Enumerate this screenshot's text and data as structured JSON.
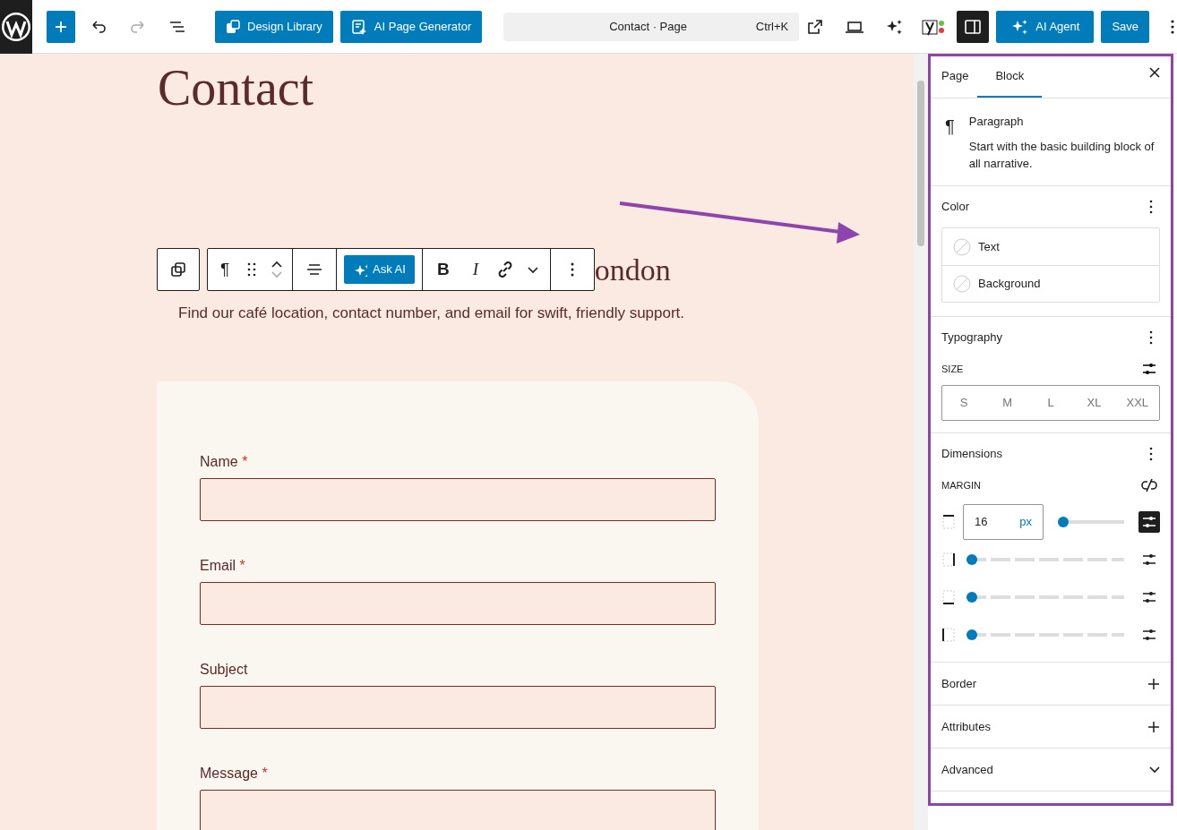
{
  "topbar": {
    "design_library": "Design Library",
    "ai_page_generator": "AI Page Generator",
    "command": {
      "title": "Contact · Page",
      "shortcut": "Ctrl+K"
    },
    "sidebar_toggle": {
      "on": true
    },
    "ai_agent": "AI Agent",
    "save": "Save"
  },
  "canvas": {
    "title": "Contact",
    "heading_fragment": "ondon",
    "block_toolbar": {
      "paragraph_glyph": "¶",
      "ask_ai": "Ask AI",
      "bold": "B",
      "italic": "I"
    },
    "paragraph": "Find our café location, contact number, and email for swift, friendly support.",
    "form": {
      "fields": [
        {
          "label": "Name",
          "required": true,
          "kind": "input"
        },
        {
          "label": "Email",
          "required": true,
          "kind": "input"
        },
        {
          "label": "Subject",
          "required": false,
          "kind": "input"
        },
        {
          "label": "Message",
          "required": true,
          "kind": "textarea"
        }
      ],
      "required_mark": "*"
    }
  },
  "sidebar": {
    "tabs": [
      {
        "label": "Page",
        "selected": false
      },
      {
        "label": "Block",
        "selected": true
      }
    ],
    "block": {
      "glyph": "¶",
      "name": "Paragraph",
      "description": "Start with the basic building block of all narrative."
    },
    "color": {
      "title": "Color",
      "items": [
        {
          "label": "Text"
        },
        {
          "label": "Background"
        }
      ]
    },
    "typography": {
      "title": "Typography",
      "size_label": "SIZE",
      "sizes": [
        {
          "label": "S",
          "selected": false
        },
        {
          "label": "M",
          "selected": false
        },
        {
          "label": "L",
          "selected": false
        },
        {
          "label": "XL",
          "selected": false
        },
        {
          "label": "XXL",
          "selected": false
        }
      ]
    },
    "dimensions": {
      "title": "Dimensions",
      "margin_label": "MARGIN",
      "sides": [
        {
          "kind": "input",
          "value": "16",
          "unit": "px",
          "level": 0,
          "custom": true
        },
        {
          "kind": "slider",
          "level": 0,
          "custom": false
        },
        {
          "kind": "slider",
          "level": 0,
          "custom": false
        },
        {
          "kind": "slider",
          "level": 0,
          "custom": false
        }
      ]
    },
    "panels": [
      {
        "title": "Border",
        "kind": "add"
      },
      {
        "title": "Attributes",
        "kind": "add"
      },
      {
        "title": "Advanced",
        "kind": "collapse"
      }
    ]
  }
}
